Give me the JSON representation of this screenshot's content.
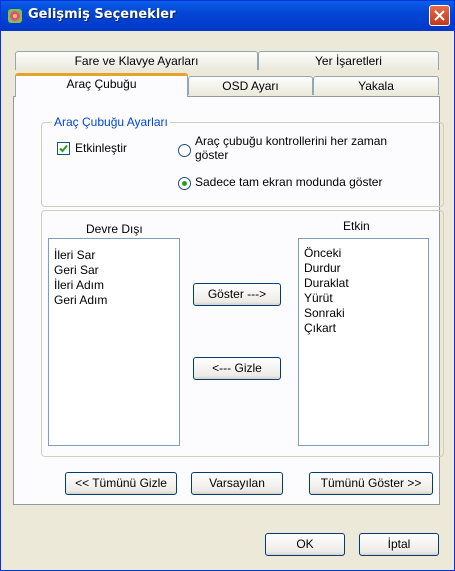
{
  "window": {
    "title": "Gelişmiş Seçenekler"
  },
  "tabs": {
    "row_back": [
      "Fare ve Klavye Ayarları",
      "Yer İşaretleri"
    ],
    "row_front": [
      "Araç Çubuğu",
      "OSD Ayarı",
      "Yakala"
    ]
  },
  "toolbar_settings": {
    "legend": "Araç Çubuğu Ayarları",
    "enable_label": "Etkinleştir",
    "enable_checked": true,
    "radio_always_line1": "Araç çubuğu kontrollerini her zaman",
    "radio_always_line2": "göster",
    "radio_fullscreen": "Sadece tam ekran modunda göster",
    "selected_option": "fullscreen"
  },
  "lists": {
    "disabled_title": "Devre Dışı",
    "disabled_items": [
      "İleri Sar",
      "Geri Sar",
      "İleri Adım",
      "Geri Adım"
    ],
    "enabled_title": "Etkin",
    "enabled_items": [
      "Önceki",
      "Durdur",
      "Duraklat",
      "Yürüt",
      "Sonraki",
      "Çıkart"
    ]
  },
  "buttons": {
    "show": "Göster --->",
    "hide": "<--- Gizle",
    "hide_all": "<< Tümünü Gizle",
    "default": "Varsayılan",
    "show_all": "Tümünü Göster >>",
    "ok": "OK",
    "cancel": "İptal"
  },
  "colors": {
    "title_bar": "#0446d6",
    "tab_highlight": "#e6a22a",
    "group_legend": "#0046d5",
    "check_mark": "#21a121"
  }
}
